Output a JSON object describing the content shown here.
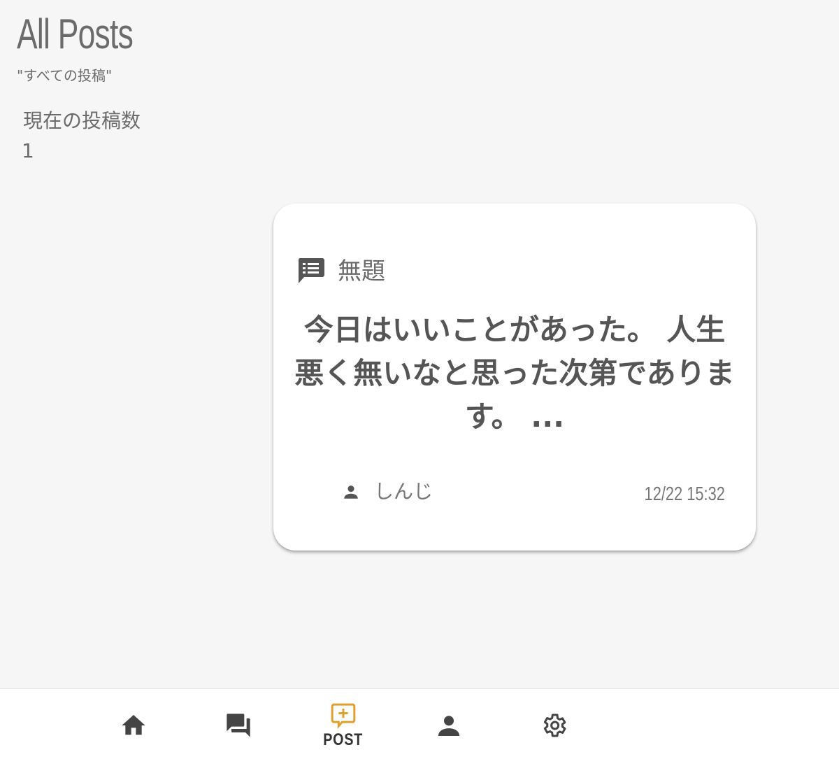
{
  "header": {
    "title": "All Posts",
    "subtitle": "\"すべての投稿\""
  },
  "stats": {
    "count_label": "現在の投稿数",
    "count_value": "1"
  },
  "post": {
    "icon": "comment-text-icon",
    "title": "無題",
    "body": "今日はいいことがあった。 人生悪く無いなと思った次第であります。 ...",
    "author_icon": "person-icon",
    "author": "しんじ",
    "timestamp": "12/22 15:32"
  },
  "nav": {
    "items": [
      {
        "icon": "home-icon",
        "label": ""
      },
      {
        "icon": "forum-icon",
        "label": ""
      },
      {
        "icon": "add-comment-icon",
        "label": "POST",
        "active": true
      },
      {
        "icon": "person-icon",
        "label": ""
      },
      {
        "icon": "gear-icon",
        "label": ""
      }
    ]
  },
  "colors": {
    "background": "#f6f6f6",
    "card": "#ffffff",
    "text": "#555555",
    "accent": "#e0a030",
    "icon": "#555555"
  }
}
